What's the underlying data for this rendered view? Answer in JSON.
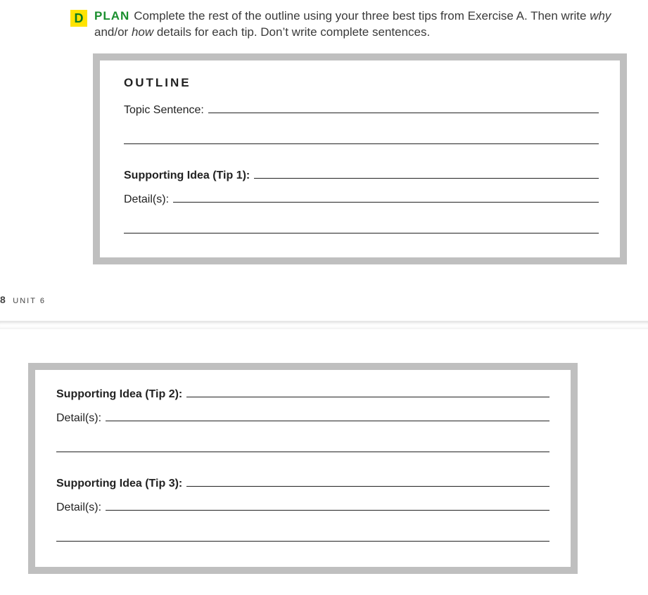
{
  "exercise": {
    "letter": "D",
    "plan_label": "PLAN",
    "instructions_part1": "Complete the rest of the outline using your three best tips from Exercise A. Then write ",
    "why_word": "why",
    "andor": " and/or ",
    "how_word": "how",
    "instructions_part2": " details for each tip. Don’t write complete sentences."
  },
  "outline": {
    "title": "OUTLINE",
    "topic_label": "Topic Sentence:",
    "tip1_label": "Supporting Idea (Tip 1):",
    "tip2_label": "Supporting Idea (Tip 2):",
    "tip3_label": "Supporting Idea (Tip 3):",
    "details_label": "Detail(s):"
  },
  "footer": {
    "page_number": "8",
    "unit_label": "UNIT 6"
  }
}
